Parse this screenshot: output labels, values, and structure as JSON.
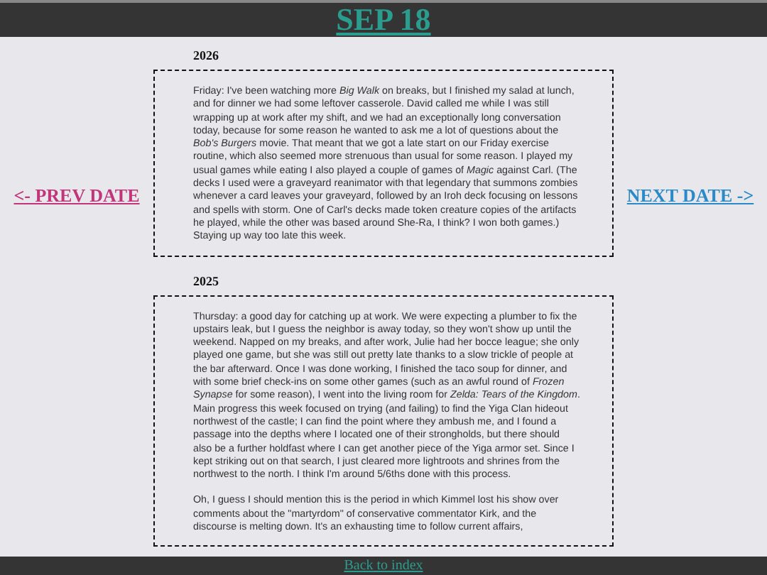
{
  "header": {
    "title": "SEP 18"
  },
  "nav": {
    "prev": "<- PREV DATE",
    "next": "NEXT DATE ->"
  },
  "entries": [
    {
      "year": "2026",
      "paragraphs": [
        "Friday: I've been watching more *Big Walk* on breaks, but I finished my salad at lunch, and for dinner we had some leftover casserole. David called me while I was still wrapping up at work after my shift, and we had an exceptionally long conversation today, because for some reason he wanted to ask me a lot of questions about the *Bob's Burgers* movie. That meant that we got a late start on our Friday exercise routine, which also seemed more strenuous than usual for some reason. I played my usual games while eating I also played a couple of games of *Magic* against Carl. (The decks I used were a graveyard reanimator with that legendary that summons zombies whenever a card leaves your graveyard, followed by an Iroh deck focusing on lessons and spells with storm. One of Carl's decks made token creature copies of the artifacts he played, while the other was based around She-Ra, I think? I won both games.) Staying up way too late this week."
      ]
    },
    {
      "year": "2025",
      "paragraphs": [
        "Thursday: a good day for catching up at work. We were expecting a plumber to fix the upstairs leak, but I guess the neighbor is away today, so they won't show up until the weekend. Napped on my breaks, and after work, Julie had her bocce league; she only played one game, but she was still out pretty late thanks to a slow trickle of people at the bar afterward. Once I was done working, I finished the taco soup for dinner, and with some brief check-ins on some other games (such as an awful round of *Frozen Synapse* for some reason), I went into the living room for *Zelda: Tears of the Kingdom*. Main progress this week focused on trying (and failing) to find the Yiga Clan hideout northwest of the castle; I can find the point where they ambush me, and I found a passage into the depths where I located one of their strongholds, but there should also be a further holdfast where I can get another piece of the Yiga armor set. Since I kept striking out on that search, I just cleared more lightroots and shrines from the northwest to the north. I think I'm around 5/6ths done with this process.",
        "Oh, I guess I should mention this is the period in which Kimmel lost his show over comments about the \"martyrdom\" of conservative commentator Kirk, and the discourse is melting down. It's an exhausting time to follow current affairs,"
      ]
    }
  ],
  "footer": {
    "link": "Back to index"
  }
}
